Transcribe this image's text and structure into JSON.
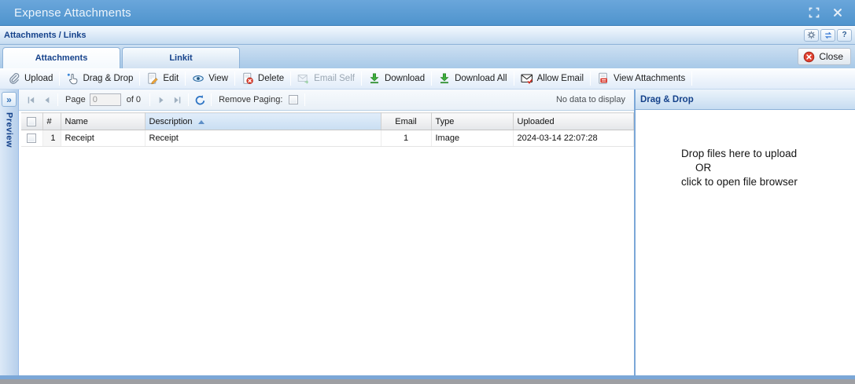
{
  "window": {
    "title": "Expense Attachments"
  },
  "headerbar": {
    "title": "Attachments / Links"
  },
  "tabs": {
    "attachments": "Attachments",
    "linkit": "Linkit",
    "close_label": "Close"
  },
  "toolbar": {
    "items": [
      {
        "label": "Upload",
        "icon": "paperclip-icon",
        "enabled": true
      },
      {
        "label": "Drag & Drop",
        "icon": "hand-pointer-icon",
        "enabled": true
      },
      {
        "label": "Edit",
        "icon": "page-pencil-icon",
        "enabled": true
      },
      {
        "label": "View",
        "icon": "eye-icon",
        "enabled": true
      },
      {
        "label": "Delete",
        "icon": "page-delete-icon",
        "enabled": true
      },
      {
        "label": "Email Self",
        "icon": "email-send-icon",
        "enabled": false
      },
      {
        "label": "Download",
        "icon": "download-icon",
        "enabled": true
      },
      {
        "label": "Download All",
        "icon": "download-icon",
        "enabled": true
      },
      {
        "label": "Allow Email",
        "icon": "envelope-check-icon",
        "enabled": true
      },
      {
        "label": "View Attachments",
        "icon": "page-red-icon",
        "enabled": true
      }
    ]
  },
  "paging": {
    "page_label": "Page",
    "page_value": "0",
    "of_label": "of 0",
    "remove_paging_label": "Remove Paging:",
    "no_data": "No data to display"
  },
  "preview": {
    "label": "Preview"
  },
  "grid": {
    "columns": [
      "#",
      "Name",
      "Description",
      "Email",
      "Type",
      "Uploaded"
    ],
    "sorted_column": "Description",
    "sort_direction": "asc",
    "rows": [
      {
        "num": "1",
        "name": "Receipt",
        "description": "Receipt",
        "email": "1",
        "type": "Image",
        "uploaded": "2024-03-14 22:07:28"
      }
    ]
  },
  "dropzone": {
    "header": "Drag & Drop",
    "line1": "Drop files here to upload",
    "line2": "OR",
    "line3": "click to open file browser"
  },
  "icons": {
    "expand": "»",
    "help": "?"
  },
  "colors": {
    "accent": "#15428b",
    "titlebar": "#5b9bd5",
    "danger": "#e0402f",
    "success": "#3fae3f"
  }
}
